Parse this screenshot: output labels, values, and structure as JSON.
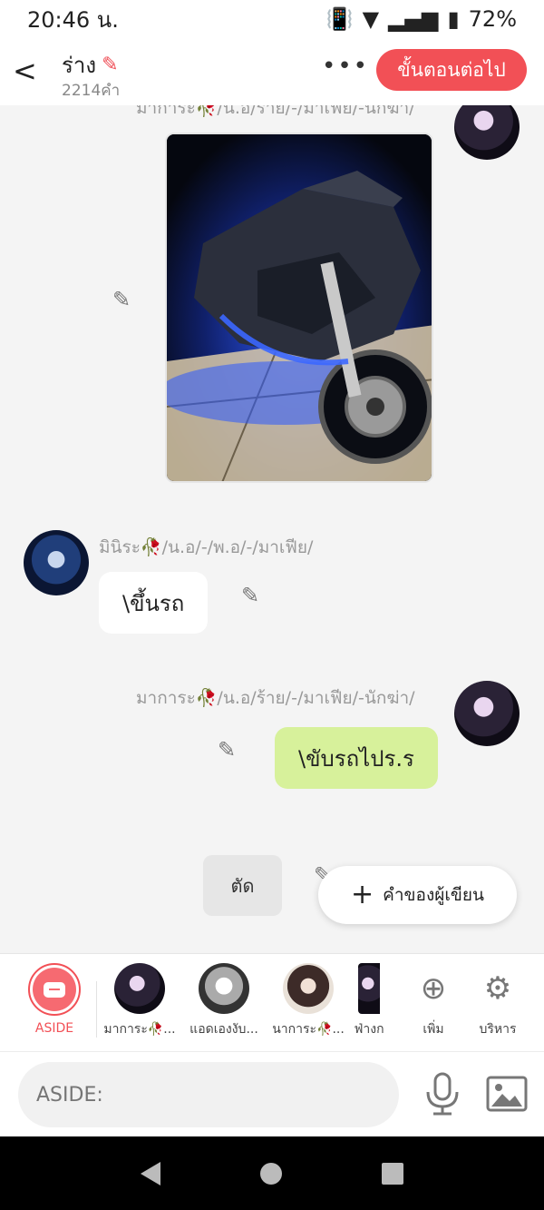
{
  "status": {
    "time": "20:46 น.",
    "battery": "72%"
  },
  "header": {
    "title": "ร่าง",
    "word_count": "2214คำ",
    "more_label": "•••",
    "next_button": "ขั้นตอนต่อไป",
    "back_label": "<"
  },
  "messages": [
    {
      "type": "image",
      "sender": "มาการะ🥀/น.อ/ร้าย/-/มาเฟีย/-นักฆ่า/",
      "side": "right"
    },
    {
      "type": "text",
      "sender": "มินิระ🥀/น.อ/-/พ.อ/-/มาเฟีย/",
      "text": "\\ขึ้นรถ",
      "side": "left"
    },
    {
      "type": "text",
      "sender": "มาการะ🥀/น.อ/ร้าย/-/มาเฟีย/-นักฆ่า/",
      "text": "\\ขับรถไปร.ร",
      "side": "right"
    }
  ],
  "actions": {
    "cut": "ตัด",
    "author_note": "คำของผู้เขียน"
  },
  "characters": [
    {
      "label": "ASIDE"
    },
    {
      "label": "มาการะ🥀..."
    },
    {
      "label": "แอดเองงับ..."
    },
    {
      "label": "นาการะ🥀..."
    },
    {
      "label": "ฟ่างก"
    }
  ],
  "tools": {
    "add": "เพิ่ม",
    "manage": "บริหาร"
  },
  "input": {
    "placeholder": "ASIDE:"
  },
  "colors": {
    "accent": "#f25056",
    "bubble_green": "#d7f19b"
  }
}
